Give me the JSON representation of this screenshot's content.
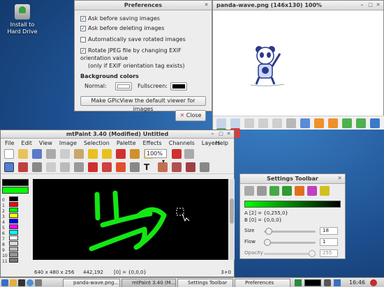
{
  "desktop": {
    "install_label": "Install to\nHard Drive"
  },
  "preferences": {
    "title": "Preferences",
    "options": [
      {
        "label": "Ask before saving images",
        "checked": true
      },
      {
        "label": "Ask before deleting images",
        "checked": true
      },
      {
        "label": "Automatically save rotated images",
        "checked": false
      },
      {
        "label": "Rotate JPEG file by changing EXIF orientation value",
        "checked": true
      }
    ],
    "option_note": "(only if EXIF orientation tag exists)",
    "bg_heading": "Background colors",
    "normal_label": "Normal:",
    "fullscreen_label": "Fullscreen:",
    "normal_color": "#ffffff",
    "fullscreen_color": "#000000",
    "default_viewer_button": "Make GPicView the default viewer for images",
    "close_button": "Close"
  },
  "gpicview": {
    "title": "panda-wave.png (146x130) 100%"
  },
  "mtpaint": {
    "title": "mtPaint 3.40 (Modified) Untitled",
    "menu": [
      "File",
      "Edit",
      "View",
      "Image",
      "Selection",
      "Palette",
      "Effects",
      "Channels",
      "Layers",
      "Help"
    ],
    "zoom": "100%",
    "palette_labels": [
      "0",
      "1",
      "2",
      "3",
      "4",
      "5",
      "6",
      "7",
      "8",
      "9",
      "10",
      "11"
    ],
    "palette_colors": [
      "#000000",
      "#ff0000",
      "#00ff00",
      "#ffff00",
      "#0000ff",
      "#ff00ff",
      "#00ffff",
      "#ffffff",
      "#dddddd",
      "#bbbbbb",
      "#999999",
      "#777777"
    ],
    "status": {
      "size": "640 x 480 x 256",
      "coords": "442,192",
      "pixel": "[0] = {0,0,0}",
      "zoom": "3+0"
    },
    "draw_color": "#14e614"
  },
  "settings_toolbar": {
    "title": "Settings Toolbar",
    "a_label": "A [2] = {0,255,0}",
    "b_label": "B [0] = {0,0,0}",
    "size_label": "Size",
    "size_value": "18",
    "flow_label": "Flow",
    "flow_value": "1",
    "opacity_label": "Opacity",
    "opacity_value": "255"
  },
  "taskbar": {
    "items": [
      "panda-wave.png...",
      "mtPaint 3.40 (M...",
      "Settings Toolbar",
      "Preferences"
    ],
    "clock": "16:46"
  }
}
